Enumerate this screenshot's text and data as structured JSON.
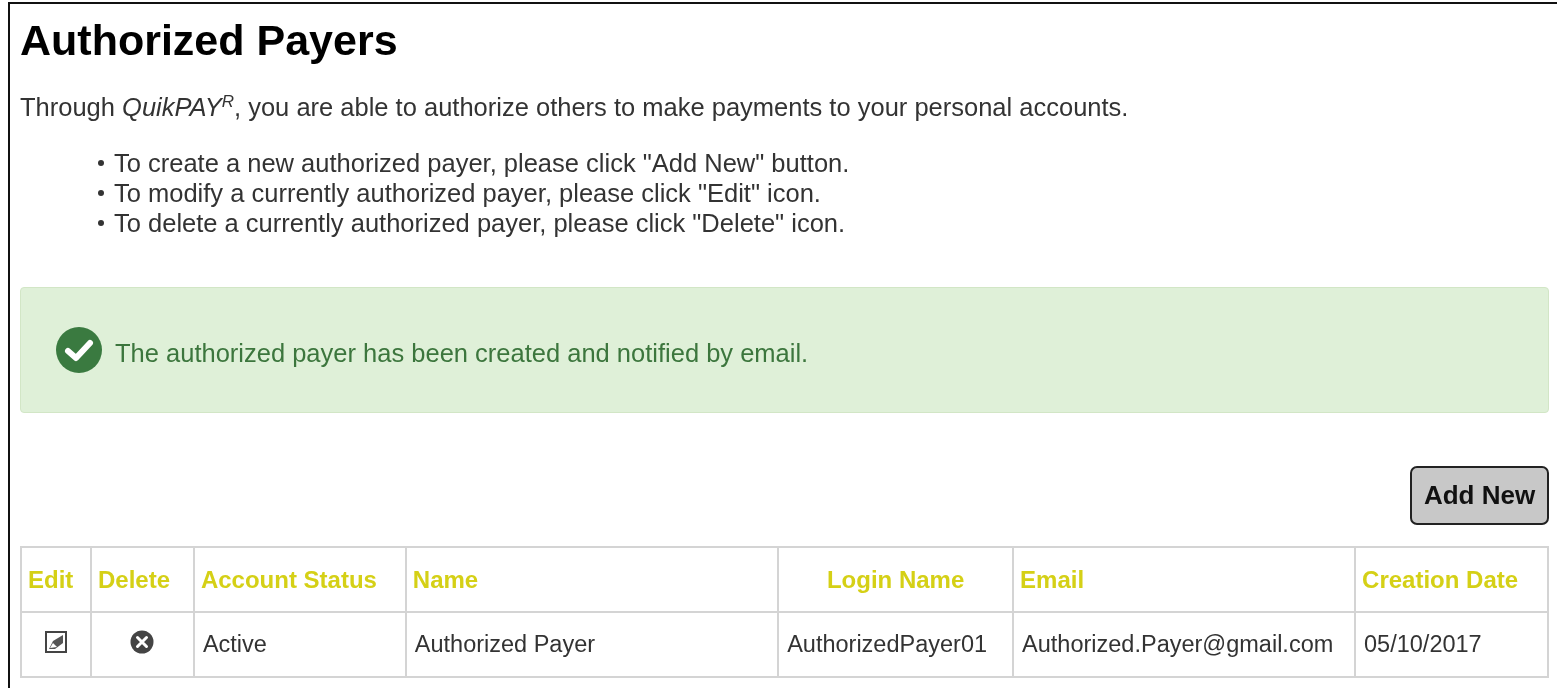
{
  "title": "Authorized Payers",
  "intro": "Through *QuikPAY*$^{R}$, you are able to authorize others to make payments to your personal accounts.",
  "instructions": [
    "To create a new authorized payer, please click \"Add New\" button.",
    "To modify a currently authorized payer, please click \"Edit\" icon.",
    "To delete a currently authorized payer, please click \"Delete\" icon."
  ],
  "alert": {
    "kind": "success",
    "message": "The authorized payer has been created and notified by email."
  },
  "add_button": "Add New",
  "table": {
    "columns": [
      {
        "label": "Edit"
      },
      {
        "label": "Delete"
      },
      {
        "label": "Account Status"
      },
      {
        "label": "Name"
      },
      {
        "label": "Login Name"
      },
      {
        "label": "Email"
      },
      {
        "label": "Creation Date"
      }
    ],
    "rows": [
      {
        "cells": [
          {
            "kind": "edit"
          },
          {
            "kind": "delete"
          },
          {
            "kind": "text",
            "text": "Active"
          },
          {
            "kind": "text",
            "text": "Authorized Payer"
          },
          {
            "kind": "text",
            "text": "AuthorizedPayer01"
          },
          {
            "kind": "text",
            "text": "Authorized.Payer@gmail.com"
          },
          {
            "kind": "text",
            "text": "05/10/2017"
          }
        ]
      }
    ]
  }
}
